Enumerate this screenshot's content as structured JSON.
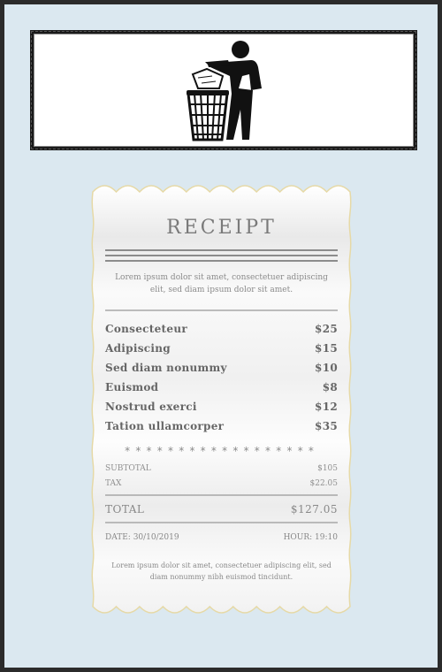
{
  "sign": {
    "icon": "tidy-man-litter-bin-icon"
  },
  "receipt": {
    "title": "RECEIPT",
    "intro": "Lorem ipsum dolor sit amet, consectetuer adipiscing elit, sed diam ipsum dolor sit amet.",
    "items": [
      {
        "name": "Consecteteur",
        "price": "$25"
      },
      {
        "name": "Adipiscing",
        "price": "$15"
      },
      {
        "name": "Sed diam nonummy",
        "price": "$10"
      },
      {
        "name": "Euismod",
        "price": "$8"
      },
      {
        "name": "Nostrud exerci",
        "price": "$12"
      },
      {
        "name": "Tation ullamcorper",
        "price": "$35"
      }
    ],
    "stars": "******************",
    "subtotal_label": "SUBTOTAL",
    "subtotal_value": "$105",
    "tax_label": "TAX",
    "tax_value": "$22.05",
    "total_label": "TOTAL",
    "total_value": "$127.05",
    "date": "DATE: 30/10/2019",
    "hour": "HOUR: 19:10",
    "footer": "Lorem ipsum dolor sit amet, consectetuer adipiscing elit, sed diam nonummy nibh euismod tincidunt."
  },
  "colors": {
    "background": "#dbe8f0",
    "frame": "#2b2b2b",
    "sign_border": "#1a1a1a",
    "receipt_edge": "#e8dcaa"
  }
}
